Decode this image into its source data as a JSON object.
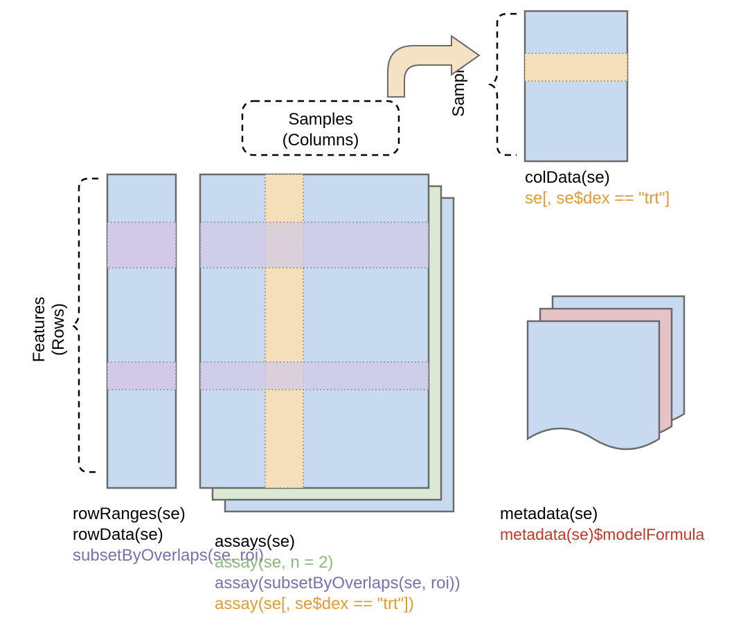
{
  "colors": {
    "blueFill": "#C7DAEF",
    "greenFill": "#D9E9D3",
    "pinkFill": "#E7C3C7",
    "orangeBand": "#F5DFB9",
    "purpleBand": "#D1C9E6",
    "stroke": "#6A6A6A",
    "black": "#000000",
    "orangeText": "#E49A33",
    "purpleText": "#7B6FB2",
    "greenText": "#8DB97C",
    "redText": "#C0392B",
    "arrowFill": "#F5E2C4"
  },
  "topDashed": {
    "line1": "Samples",
    "line2": "(Columns)"
  },
  "leftDashed": {
    "line1": "Features",
    "line2": "(Rows)"
  },
  "rightDashed": "Samples",
  "rowRanges": {
    "l1": "rowRanges(se)",
    "l2": "rowData(se)",
    "l3": "subsetByOverlaps(se, roi)"
  },
  "colData": {
    "l1": "colData(se)",
    "l2": "se[, se$dex == \"trt\"]"
  },
  "assays": {
    "l1": "assays(se)",
    "l2": "assay(se, n = 2)",
    "l3": "assay(subsetByOverlaps(se, roi))",
    "l4": "assay(se[, se$dex == \"trt\"])"
  },
  "metadata": {
    "l1": "metadata(se)",
    "l2": "metadata(se)$modelFormula"
  }
}
